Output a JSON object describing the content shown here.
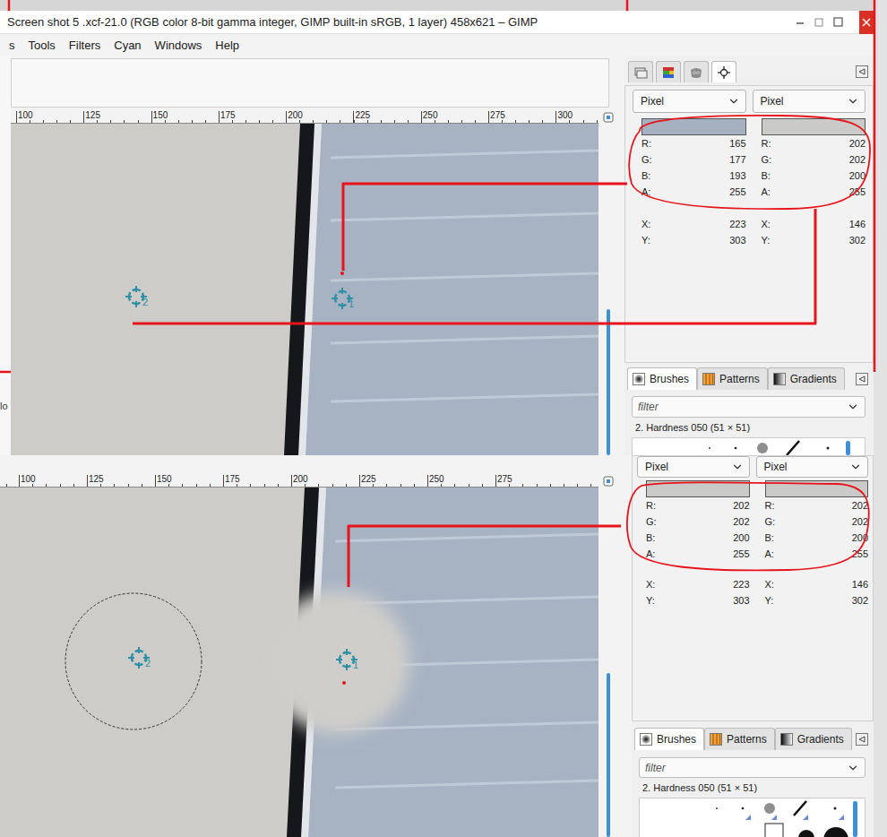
{
  "top_window": {
    "title": "Screen shot 5 .xcf-21.0 (RGB color 8-bit gamma integer, GIMP built-in sRGB, 1 layer) 458x621 – GIMP",
    "menu": [
      "s",
      "Tools",
      "Filters",
      "Cyan",
      "Windows",
      "Help"
    ],
    "side_peek": "lo",
    "ruler": [
      "100",
      "125",
      "150",
      "175",
      "200",
      "225",
      "250",
      "275",
      "300"
    ],
    "canvas": {
      "sample_points": [
        {
          "label": "1"
        },
        {
          "label": "2"
        }
      ]
    },
    "dock_tabs": [
      {
        "selected": false
      },
      {
        "selected": false
      },
      {
        "selected": false
      },
      {
        "selected": true
      }
    ],
    "pointer": {
      "columns": [
        {
          "mode": "Pixel",
          "color": "#a5b1c1",
          "channels": [
            {
              "label": "R:",
              "value": "165"
            },
            {
              "label": "G:",
              "value": "177"
            },
            {
              "label": "B:",
              "value": "193"
            },
            {
              "label": "A:",
              "value": "255"
            }
          ],
          "position": [
            {
              "label": "X:",
              "value": "223"
            },
            {
              "label": "Y:",
              "value": "303"
            }
          ]
        },
        {
          "mode": "Pixel",
          "color": "#cacac8",
          "channels": [
            {
              "label": "R:",
              "value": "202"
            },
            {
              "label": "G:",
              "value": "202"
            },
            {
              "label": "B:",
              "value": "200"
            },
            {
              "label": "A:",
              "value": "255"
            }
          ],
          "position": [
            {
              "label": "X:",
              "value": "146"
            },
            {
              "label": "Y:",
              "value": "302"
            }
          ]
        }
      ]
    },
    "brush_tabs": [
      {
        "label": "Brushes",
        "selected": true
      },
      {
        "label": "Patterns",
        "selected": false
      },
      {
        "label": "Gradients",
        "selected": false
      }
    ],
    "filter": {
      "placeholder": "filter"
    },
    "brush_name": "2. Hardness 050 (51 × 51)"
  },
  "bottom_window": {
    "ruler": [
      "100",
      "125",
      "150",
      "175",
      "200",
      "225",
      "250",
      "275"
    ],
    "canvas": {
      "sample_points": [
        {
          "label": "1"
        },
        {
          "label": "2"
        }
      ]
    },
    "pointer": {
      "columns": [
        {
          "mode": "Pixel",
          "color": "#cacac8",
          "channels": [
            {
              "label": "R:",
              "value": "202"
            },
            {
              "label": "G:",
              "value": "202"
            },
            {
              "label": "B:",
              "value": "200"
            },
            {
              "label": "A:",
              "value": "255"
            }
          ],
          "position": [
            {
              "label": "X:",
              "value": "223"
            },
            {
              "label": "Y:",
              "value": "303"
            }
          ]
        },
        {
          "mode": "Pixel",
          "color": "#cacac8",
          "channels": [
            {
              "label": "R:",
              "value": "202"
            },
            {
              "label": "G:",
              "value": "202"
            },
            {
              "label": "B:",
              "value": "200"
            },
            {
              "label": "A:",
              "value": "255"
            }
          ],
          "position": [
            {
              "label": "X:",
              "value": "146"
            },
            {
              "label": "Y:",
              "value": "302"
            }
          ]
        }
      ]
    },
    "brush_tabs": [
      {
        "label": "Brushes",
        "selected": true
      },
      {
        "label": "Patterns",
        "selected": false
      },
      {
        "label": "Gradients",
        "selected": false
      }
    ],
    "filter": {
      "placeholder": "filter"
    },
    "brush_name": "2. Hardness 050 (51 × 51)"
  }
}
